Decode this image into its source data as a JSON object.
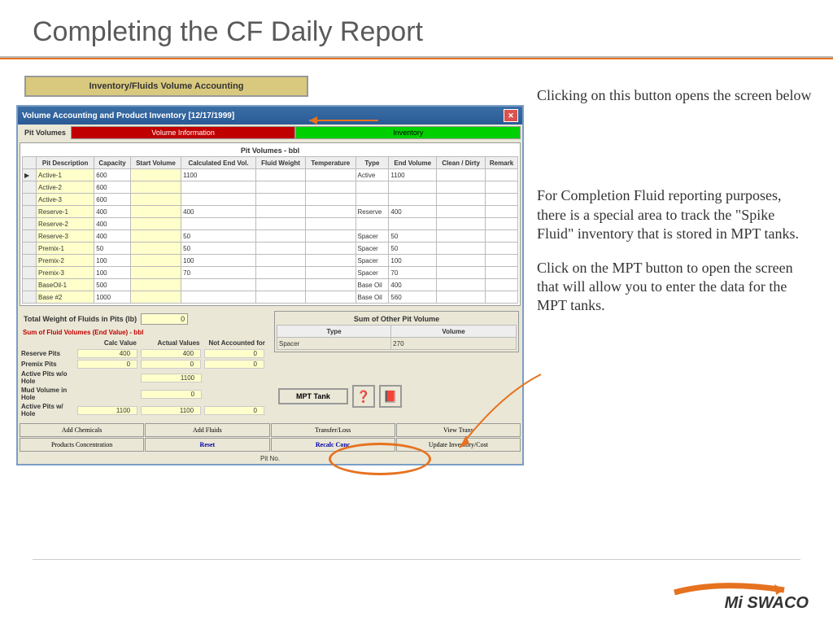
{
  "title": "Completing the CF Daily Report",
  "inv_button": "Inventory/Fluids Volume Accounting",
  "callout1": "Clicking on this button opens  the screen below",
  "body_text": "For Completion Fluid reporting  purposes,  there is a special area to track the \"Spike Fluid\" inventory that is stored in MPT tanks.",
  "callout2": "Click on the MPT button to open the screen  that will allow you to  enter the data for the MPT tanks.",
  "window": {
    "title": "Volume Accounting and Product Inventory [12/17/1999]",
    "tab_pit": "Pit Volumes",
    "tab_vol": "Volume Information",
    "tab_inv": "Inventory",
    "grid_title": "Pit Volumes - bbl",
    "headers": [
      "",
      "Pit Description",
      "Capacity",
      "Start Volume",
      "Calculated End Vol.",
      "Fluid Weight",
      "Temperature",
      "Type",
      "End Volume",
      "Clean / Dirty",
      "Remark"
    ],
    "rows": [
      {
        "ind": "▶",
        "desc": "Active-1",
        "cap": "600",
        "sv": "",
        "cev": "1100",
        "fw": "",
        "temp": "",
        "type": "Active",
        "ev": "1100",
        "cd": "",
        "rem": ""
      },
      {
        "ind": "",
        "desc": "Active-2",
        "cap": "600",
        "sv": "",
        "cev": "",
        "fw": "",
        "temp": "",
        "type": "",
        "ev": "",
        "cd": "",
        "rem": ""
      },
      {
        "ind": "",
        "desc": "Active-3",
        "cap": "600",
        "sv": "",
        "cev": "",
        "fw": "",
        "temp": "",
        "type": "",
        "ev": "",
        "cd": "",
        "rem": ""
      },
      {
        "ind": "",
        "desc": "Reserve-1",
        "cap": "400",
        "sv": "",
        "cev": "400",
        "fw": "",
        "temp": "",
        "type": "Reserve",
        "ev": "400",
        "cd": "",
        "rem": ""
      },
      {
        "ind": "",
        "desc": "Reserve-2",
        "cap": "400",
        "sv": "",
        "cev": "",
        "fw": "",
        "temp": "",
        "type": "",
        "ev": "",
        "cd": "",
        "rem": ""
      },
      {
        "ind": "",
        "desc": "Reserve-3",
        "cap": "400",
        "sv": "",
        "cev": "50",
        "fw": "",
        "temp": "",
        "type": "Spacer",
        "ev": "50",
        "cd": "",
        "rem": ""
      },
      {
        "ind": "",
        "desc": "Premix-1",
        "cap": "50",
        "sv": "",
        "cev": "50",
        "fw": "",
        "temp": "",
        "type": "Spacer",
        "ev": "50",
        "cd": "",
        "rem": ""
      },
      {
        "ind": "",
        "desc": "Premix-2",
        "cap": "100",
        "sv": "",
        "cev": "100",
        "fw": "",
        "temp": "",
        "type": "Spacer",
        "ev": "100",
        "cd": "",
        "rem": ""
      },
      {
        "ind": "",
        "desc": "Premix-3",
        "cap": "100",
        "sv": "",
        "cev": "70",
        "fw": "",
        "temp": "",
        "type": "Spacer",
        "ev": "70",
        "cd": "",
        "rem": ""
      },
      {
        "ind": "",
        "desc": "BaseOil-1",
        "cap": "500",
        "sv": "",
        "cev": "",
        "fw": "",
        "temp": "",
        "type": "Base Oil",
        "ev": "400",
        "cd": "",
        "rem": ""
      },
      {
        "ind": "",
        "desc": "Base #2",
        "cap": "1000",
        "sv": "",
        "cev": "",
        "fw": "",
        "temp": "",
        "type": "Base Oil",
        "ev": "560",
        "cd": "",
        "rem": ""
      }
    ],
    "total_weight_lbl": "Total Weight of Fluids in Pits (lb)",
    "total_weight_val": "0",
    "sum_title": "Sum of Fluid Volumes (End Value) - bbl",
    "sum_headers": {
      "calc": "Calc Value",
      "actual": "Actual Values",
      "not": "Not Accounted for"
    },
    "sum_rows": [
      {
        "lbl": "Reserve Pits",
        "a": "400",
        "b": "400",
        "c": "0"
      },
      {
        "lbl": "Premix Pits",
        "a": "0",
        "b": "0",
        "c": "0"
      },
      {
        "lbl": "Active Pits w/o Hole",
        "a": "",
        "b": "1100",
        "c": ""
      },
      {
        "lbl": "Mud Volume in Hole",
        "a": "",
        "b": "0",
        "c": ""
      },
      {
        "lbl": "Active Pits w/ Hole",
        "a": "1100",
        "b": "1100",
        "c": "0"
      }
    ],
    "other_box_title": "Sum of Other Pit Volume",
    "other_type_hdr": "Type",
    "other_vol_hdr": "Volume",
    "other_type": "Spacer",
    "other_vol": "270",
    "mpt_btn": "MPT Tank",
    "bot_buttons": {
      "add_chem": "Add Chemicals",
      "add_fluids": "Add Fluids",
      "transfer": "Transfer/Loss",
      "view_trans": "View Trans",
      "prod_conc": "Products Concentration",
      "reset": "Reset",
      "recalc": "Recalc Conc",
      "update": "Update Inventory/Cost"
    },
    "foot": "Pit No."
  },
  "logo": {
    "brand": "Mi SWACO"
  }
}
